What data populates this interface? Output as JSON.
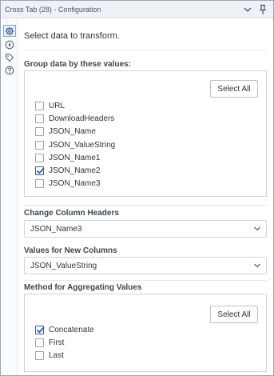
{
  "window": {
    "title": "Cross Tab (28) - Configuration"
  },
  "sidebar": {
    "overflow": "···",
    "items": [
      {
        "icon": "gear-icon",
        "active": true
      },
      {
        "icon": "compass-icon",
        "active": false
      },
      {
        "icon": "tag-icon",
        "active": false
      },
      {
        "icon": "help-icon",
        "active": false
      }
    ]
  },
  "intro": "Select data to transform.",
  "group": {
    "label": "Group data by these values:",
    "select_all": "Select All",
    "fields": [
      {
        "label": "URL",
        "checked": false
      },
      {
        "label": "DownloadHeaders",
        "checked": false
      },
      {
        "label": "JSON_Name",
        "checked": false
      },
      {
        "label": "JSON_ValueString",
        "checked": false
      },
      {
        "label": "JSON_Name1",
        "checked": false
      },
      {
        "label": "JSON_Name2",
        "checked": true
      },
      {
        "label": "JSON_Name3",
        "checked": false
      }
    ]
  },
  "headers": {
    "label": "Change Column Headers",
    "value": "JSON_Name3"
  },
  "values": {
    "label": "Values for New Columns",
    "value": "JSON_ValueString"
  },
  "method": {
    "label": "Method for Aggregating Values",
    "select_all": "Select All",
    "options": [
      {
        "label": "Concatenate",
        "checked": true
      },
      {
        "label": "First",
        "checked": false
      },
      {
        "label": "Last",
        "checked": false
      }
    ]
  },
  "colors": {
    "accent": "#2a5fa8",
    "border": "#cfd5dc"
  }
}
